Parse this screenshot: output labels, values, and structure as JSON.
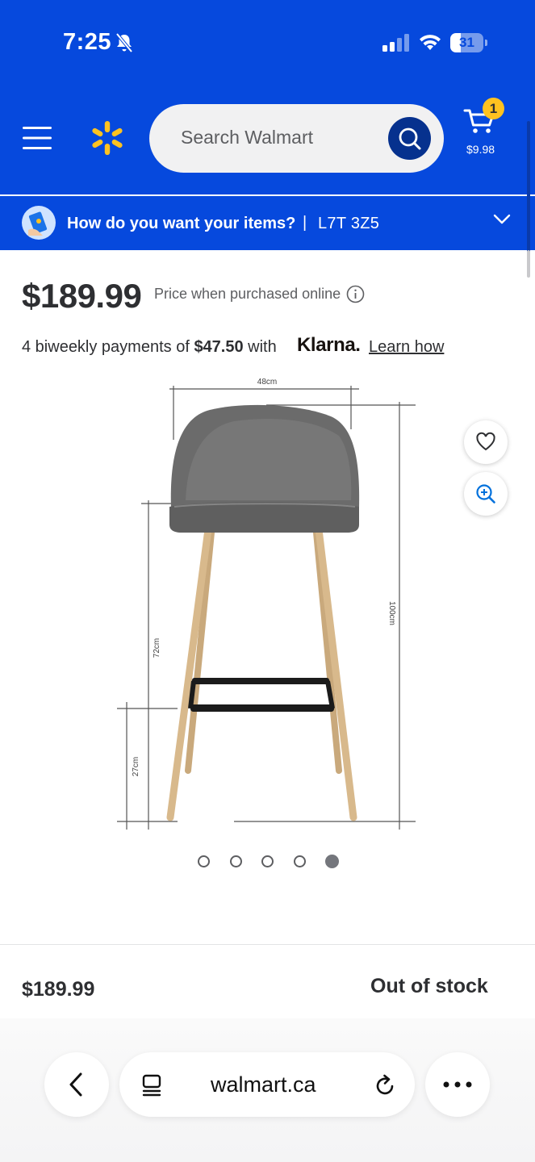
{
  "status_bar": {
    "time": "7:25",
    "battery_level": "31",
    "battery_fraction": 0.31
  },
  "header": {
    "search_placeholder": "Search Walmart",
    "cart_count": "1",
    "cart_total": "$9.98",
    "brand_color": "#0649dd",
    "accent_color": "#ffc220"
  },
  "delivery": {
    "question": "How do you want your items?",
    "separator": "|",
    "postal_code": "L7T 3Z5"
  },
  "product": {
    "price": "$189.99",
    "price_note": "Price when purchased online",
    "klarna": {
      "prefix": "4 biweekly payments of ",
      "amount": "$47.50",
      "suffix": " with",
      "logo": "Klarna.",
      "link": "Learn how"
    },
    "image": {
      "dim_width": "48cm",
      "dim_height_total": "100cm",
      "dim_seat": "72cm",
      "dim_footrest": "27cm"
    },
    "carousel": {
      "count": 5,
      "active_index": 4
    }
  },
  "footer": {
    "price": "$189.99",
    "stock_status": "Out of stock"
  },
  "browser": {
    "url": "walmart.ca"
  },
  "icons": {
    "menu": "hamburger-icon",
    "logo": "walmart-spark-icon",
    "search": "search-icon",
    "cart": "cart-icon",
    "favorite": "heart-icon",
    "zoom": "zoom-in-icon",
    "info": "info-icon",
    "back": "chevron-left-icon",
    "tabs": "tabs-icon",
    "reload": "reload-icon",
    "more": "more-icon"
  }
}
